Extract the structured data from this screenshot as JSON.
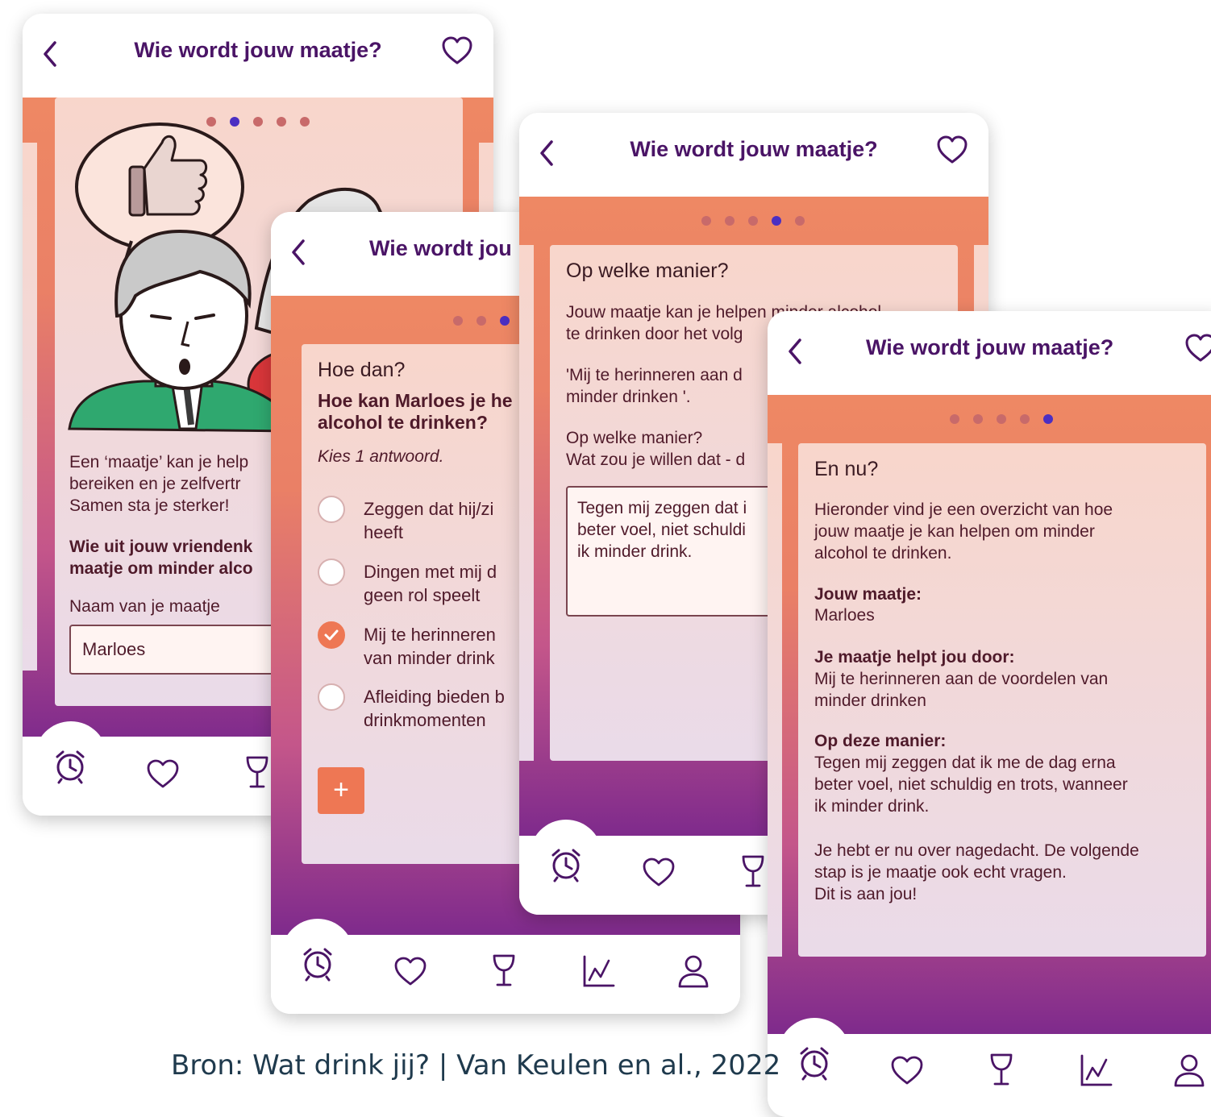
{
  "screen1": {
    "title": "Wie wordt jouw maatje?",
    "intro": [
      "Een ‘maatje’ kan je help",
      "bereiken en je zelfvertr",
      "Samen sta je sterker!"
    ],
    "question": [
      "Wie uit jouw vriendenk",
      "maatje om minder alco"
    ],
    "input_label": "Naam van je maatje",
    "input_value": "Marloes",
    "illustration_icon": "thumbs-up-illustration"
  },
  "screen2": {
    "title": "Wie wordt jou",
    "heading": "Hoe dan?",
    "question": [
      "Hoe kan Marloes je he",
      "alcohol te drinken?"
    ],
    "hint": "Kies 1 antwoord.",
    "options": [
      {
        "line1": "Zeggen dat hij/zi",
        "line2": "heeft",
        "selected": false
      },
      {
        "line1": "Dingen met mij d",
        "line2": "geen rol speelt",
        "selected": false
      },
      {
        "line1": "Mij te herinneren",
        "line2": "van minder drink",
        "selected": true
      },
      {
        "line1": "Afleiding bieden b",
        "line2": "drinkmomenten",
        "selected": false
      }
    ],
    "add_label": "+"
  },
  "screen3": {
    "title": "Wie wordt jouw maatje?",
    "heading": "Op welke manier?",
    "intro": [
      "Jouw maatje kan je helpen minder alcohol",
      "te drinken door het volg"
    ],
    "quote": [
      "'Mij te herinneren aan d",
      "minder drinken '."
    ],
    "question": [
      "Op welke manier?",
      "Wat zou je willen dat - d"
    ],
    "answer": [
      "Tegen mij zeggen dat i",
      "beter voel, niet schuldi",
      "ik minder drink."
    ]
  },
  "screen4": {
    "title": "Wie wordt jouw maatje?",
    "heading": "En nu?",
    "intro": [
      "Hieronder vind je een overzicht van hoe",
      "jouw maatje je kan helpen om minder",
      "alcohol te drinken."
    ],
    "buddy_label": "Jouw maatje:",
    "buddy_value": "Marloes",
    "help_label": "Je maatje helpt jou door:",
    "help_value": [
      "Mij te herinneren aan de voordelen van",
      "minder drinken"
    ],
    "way_label": "Op deze manier:",
    "way_value": [
      "Tegen mij zeggen dat ik me de dag erna",
      "beter voel, niet schuldig en trots, wanneer",
      "ik minder drink."
    ],
    "outro": [
      "Je hebt er nu over nagedacht. De volgende",
      "stap is je maatje ook echt vragen.",
      "Dit is aan jou!"
    ]
  },
  "nav_icons": [
    "alarm-clock-icon",
    "heart-icon",
    "wine-glass-icon",
    "chart-icon",
    "profile-icon"
  ],
  "caption": "Bron: Wat drink jij? | Van Keulen en al., 2022",
  "colors": {
    "brand_purple": "#4a1466",
    "accent_orange": "#ee7754",
    "active_dot": "#4b2fc2"
  }
}
